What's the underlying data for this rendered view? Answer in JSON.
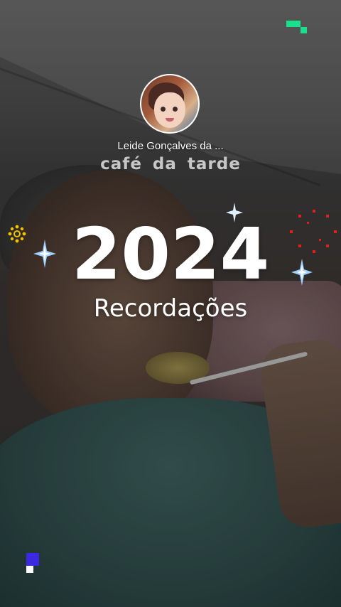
{
  "profile": {
    "username": "Leide Gonçalves da ...",
    "avatar_icon": "avatar-photo"
  },
  "post": {
    "caption": "café da tarde",
    "year": "2024",
    "subtitle": "Recordações"
  },
  "decorations": {
    "colors": {
      "pixel_green": "#19e08c",
      "pixel_blue": "#3b28e0",
      "sparkle_white": "#f4f6ff",
      "sparkle_blue": "#8fc4ff",
      "flower_yellow": "#f2c200",
      "firework_red": "#e0201e"
    }
  }
}
